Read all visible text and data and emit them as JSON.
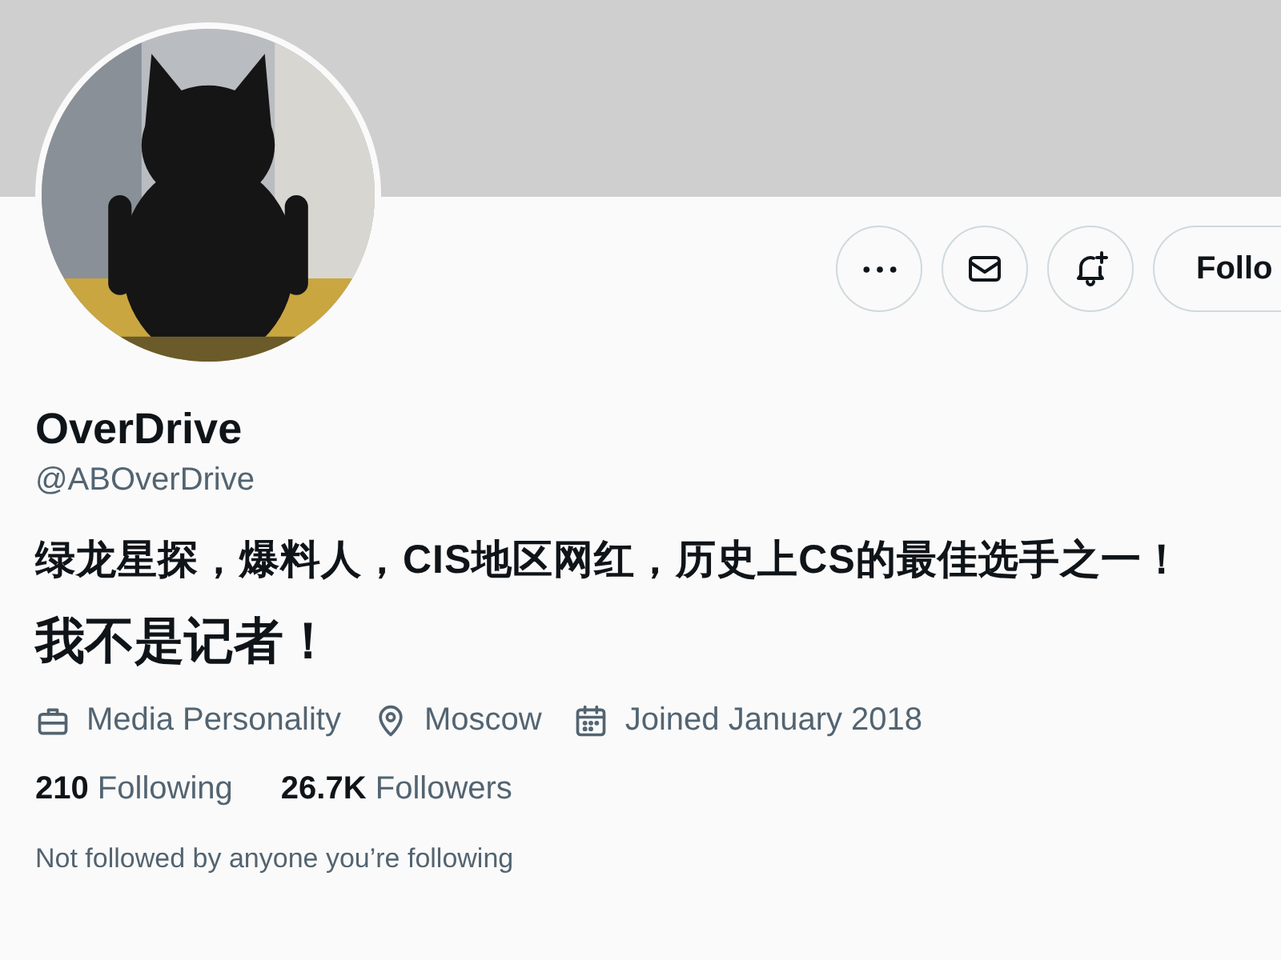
{
  "actions": [
    {
      "kind": "more"
    },
    {
      "kind": "message"
    },
    {
      "kind": "notify"
    },
    {
      "kind": "follow",
      "label": "Follo"
    }
  ],
  "name": "OverDrive",
  "handle": "@ABOverDrive",
  "bio": [
    {
      "kind": "line",
      "text": "绿龙星探，爆料人，CIS地区网红，历史上CS的最佳选手之一！"
    },
    {
      "kind": "headline",
      "text": "我不是记者！"
    }
  ],
  "meta": [
    {
      "kind": "category",
      "text": "Media Personality"
    },
    {
      "kind": "location",
      "text": "Moscow"
    },
    {
      "kind": "joined",
      "text": "Joined January 2018"
    }
  ],
  "stats": [
    {
      "count": "210",
      "label": "Following"
    },
    {
      "count": "26.7K",
      "label": "Followers"
    }
  ],
  "note": "Not followed by anyone you’re following"
}
